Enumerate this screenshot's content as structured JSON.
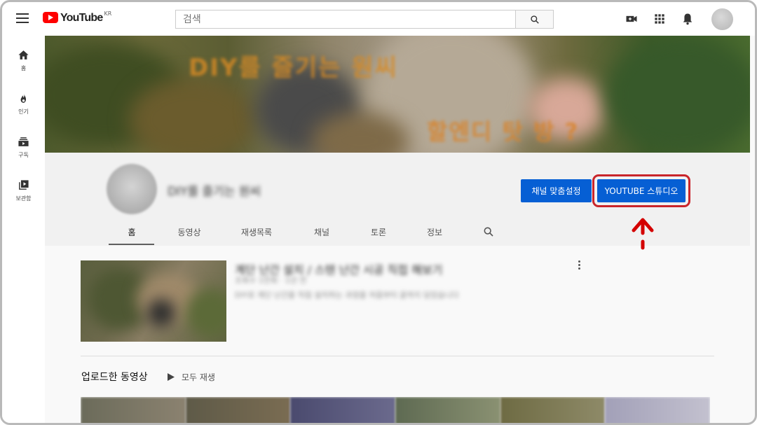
{
  "header": {
    "logo_text": "YouTube",
    "logo_region": "KR",
    "search_placeholder": "검색",
    "icons": [
      "hamburger-menu-icon",
      "search-icon",
      "video-camera-icon",
      "apps-grid-icon",
      "bell-icon"
    ]
  },
  "sidebar": {
    "items": [
      {
        "label": "홈",
        "icon": "home-icon"
      },
      {
        "label": "인기",
        "icon": "fire-icon"
      },
      {
        "label": "구독",
        "icon": "subscriptions-icon"
      },
      {
        "label": "보관함",
        "icon": "library-icon"
      }
    ]
  },
  "banner": {
    "text_top": "DIY를 즐기는 원씨",
    "text_bottom": "할엔디 탓 방 ?"
  },
  "channel": {
    "name": "DIY를 즐기는 원씨",
    "customize_button": "채널 맞춤설정",
    "studio_button": "YOUTUBE 스튜디오",
    "tabs": [
      "홈",
      "동영상",
      "재생목록",
      "채널",
      "토론",
      "정보"
    ],
    "active_tab": "홈"
  },
  "featured": {
    "title": "계단 난간 설치 / 스텐 난간 시공 직접 해보기",
    "meta": "조회수 1만회 · 1년 전",
    "description": "DIY로 계단 난간을 직접 설치하는 과정을 처음부터 끝까지 담았습니다"
  },
  "uploads": {
    "title": "업로드한 동영상",
    "play_all": "모두 재생"
  },
  "colors": {
    "brand_red": "#ff0000",
    "button_blue": "#065fd4",
    "highlight_red": "#c9252b"
  }
}
